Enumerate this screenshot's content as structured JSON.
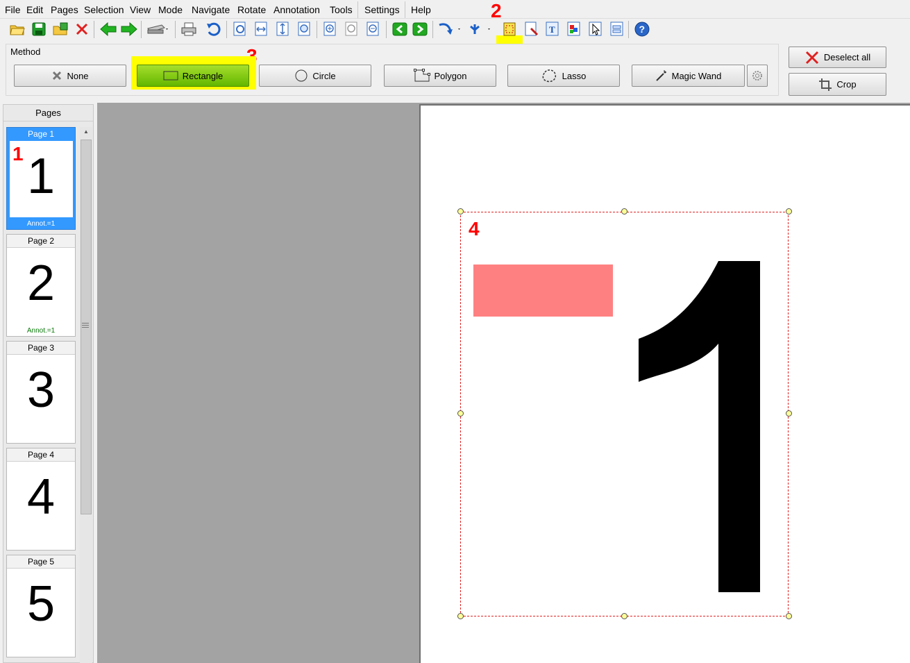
{
  "menu": {
    "items": [
      "File",
      "Edit",
      "Pages",
      "Selection",
      "View",
      "Mode",
      "Navigate",
      "Rotate",
      "Annotation",
      "Tools",
      "Settings",
      "Help"
    ]
  },
  "toolbar": {
    "icons": [
      "open-folder-icon",
      "save-icon",
      "save-as-icon",
      "close-icon",
      "back-arrow-icon",
      "forward-arrow-icon",
      "scanner-icon",
      "print-icon",
      "undo-icon",
      "zoom-fit-icon",
      "zoom-width-icon",
      "zoom-height-icon",
      "zoom-actual-icon",
      "zoom-in-icon",
      "zoom-page-icon",
      "zoom-out-icon",
      "prev-page-icon",
      "next-page-icon",
      "rotate-icon",
      "split-icon",
      "selection-tool-icon",
      "magnify-icon",
      "text-icon",
      "color-icon",
      "pointer-icon",
      "form-icon",
      "help-icon"
    ]
  },
  "annotations": {
    "a1": "1",
    "a2": "2",
    "a3": "3",
    "a4": "4"
  },
  "method": {
    "label": "Method",
    "none": "None",
    "rectangle": "Rectangle",
    "circle": "Circle",
    "polygon": "Polygon",
    "lasso": "Lasso",
    "magic_wand": "Magic Wand",
    "deselect_all": "Deselect all",
    "crop": "Crop"
  },
  "pages_panel": {
    "title": "Pages",
    "pages": [
      {
        "caption": "Page 1",
        "number": "1",
        "annot": "Annot.=1"
      },
      {
        "caption": "Page 2",
        "number": "2",
        "annot": "Annot.=1"
      },
      {
        "caption": "Page 3",
        "number": "3",
        "annot": ""
      },
      {
        "caption": "Page 4",
        "number": "4",
        "annot": ""
      },
      {
        "caption": "Page 5",
        "number": "5",
        "annot": ""
      }
    ]
  },
  "canvas": {
    "page_number": "1",
    "highlight_color": "#ff8080"
  }
}
